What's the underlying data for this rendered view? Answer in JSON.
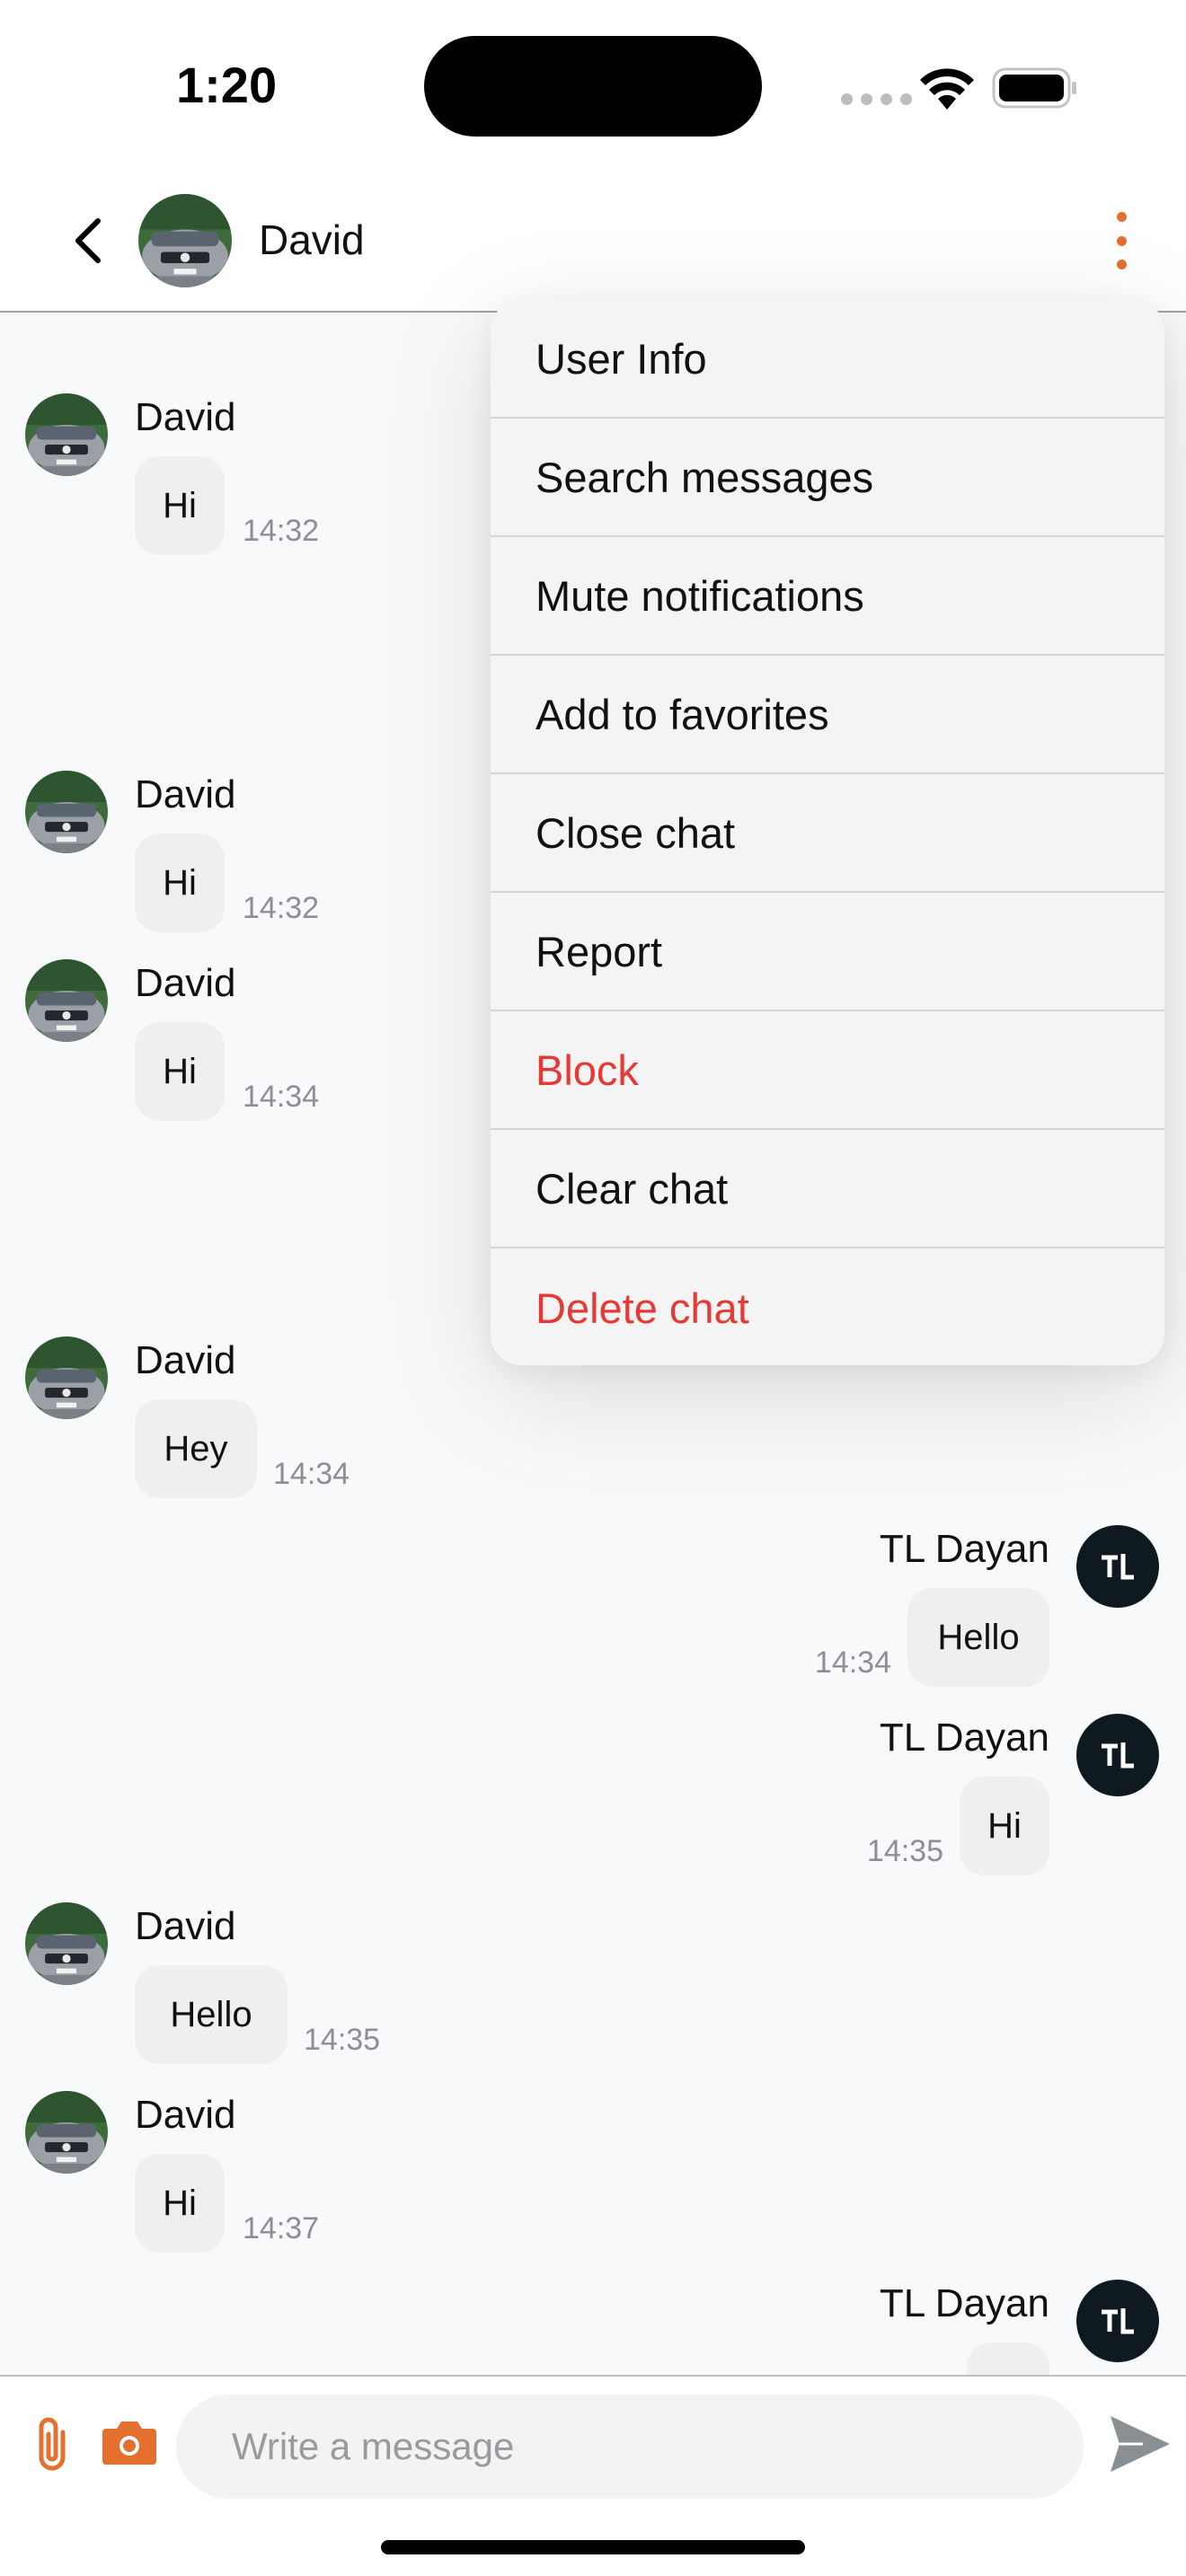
{
  "status_bar": {
    "time": "1:20"
  },
  "header": {
    "contact_name": "David",
    "back_icon": "chevron-left-icon",
    "more_icon": "more-vertical-icon",
    "accent_color": "#e46f2f"
  },
  "menu": {
    "items": [
      {
        "label": "User Info",
        "danger": false
      },
      {
        "label": "Search messages",
        "danger": false
      },
      {
        "label": "Mute notifications",
        "danger": false
      },
      {
        "label": "Add to favorites",
        "danger": false
      },
      {
        "label": "Close chat",
        "danger": false
      },
      {
        "label": "Report",
        "danger": false
      },
      {
        "label": "Block",
        "danger": true
      },
      {
        "label": "Clear chat",
        "danger": false
      },
      {
        "label": "Delete chat",
        "danger": true
      }
    ],
    "danger_color": "#e53935"
  },
  "messages": [
    {
      "sender": "David",
      "text": "Hi",
      "time": "14:32",
      "side": "left"
    },
    {
      "sender": "David",
      "text": "Hi",
      "time": "14:32",
      "side": "left"
    },
    {
      "sender": "David",
      "text": "Hi",
      "time": "14:34",
      "side": "left"
    },
    {
      "sender": "David",
      "text": "Hey",
      "time": "14:34",
      "side": "left"
    },
    {
      "sender": "TL Dayan",
      "text": "Hello",
      "time": "14:34",
      "side": "right"
    },
    {
      "sender": "TL Dayan",
      "text": "Hi",
      "time": "14:35",
      "side": "right"
    },
    {
      "sender": "David",
      "text": "Hello",
      "time": "14:35",
      "side": "left"
    },
    {
      "sender": "David",
      "text": "Hi",
      "time": "14:37",
      "side": "left"
    },
    {
      "sender": "TL Dayan",
      "text": "",
      "time": "",
      "side": "right"
    }
  ],
  "input": {
    "placeholder": "Write a message",
    "value": ""
  }
}
